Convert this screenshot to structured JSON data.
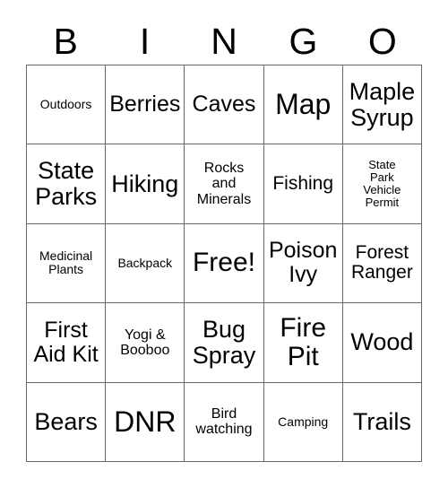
{
  "card": {
    "title": "BINGO",
    "header_letters": [
      "B",
      "I",
      "N",
      "G",
      "O"
    ],
    "border_color": "#666666",
    "text_color": "#000000",
    "background_color": "#ffffff",
    "columns": 5,
    "rows": 5,
    "free_space_index": 12,
    "cells": [
      {
        "label": "Outdoors",
        "size": "sm"
      },
      {
        "label": "Berries",
        "size": "xl"
      },
      {
        "label": "Caves",
        "size": "xl"
      },
      {
        "label": "Map",
        "size": "4xl"
      },
      {
        "label": "Maple\nSyrup",
        "size": "2xl"
      },
      {
        "label": "State\nParks",
        "size": "2xl"
      },
      {
        "label": "Hiking",
        "size": "2xl"
      },
      {
        "label": "Rocks\nand\nMinerals",
        "size": "md"
      },
      {
        "label": "Fishing",
        "size": "lg"
      },
      {
        "label": "State\nPark\nVehicle\nPermit",
        "size": "xs"
      },
      {
        "label": "Medicinal\nPlants",
        "size": "sm"
      },
      {
        "label": "Backpack",
        "size": "sm"
      },
      {
        "label": "Free!",
        "size": "3xl"
      },
      {
        "label": "Poison\nIvy",
        "size": "xl"
      },
      {
        "label": "Forest\nRanger",
        "size": "lg"
      },
      {
        "label": "First\nAid Kit",
        "size": "xl"
      },
      {
        "label": "Yogi &\nBooboo",
        "size": "md"
      },
      {
        "label": "Bug\nSpray",
        "size": "2xl"
      },
      {
        "label": "Fire\nPit",
        "size": "3xl"
      },
      {
        "label": "Wood",
        "size": "2xl"
      },
      {
        "label": "Bears",
        "size": "2xl"
      },
      {
        "label": "DNR",
        "size": "4xl"
      },
      {
        "label": "Bird\nwatching",
        "size": "md"
      },
      {
        "label": "Camping",
        "size": "sm"
      },
      {
        "label": "Trails",
        "size": "2xl"
      }
    ]
  }
}
